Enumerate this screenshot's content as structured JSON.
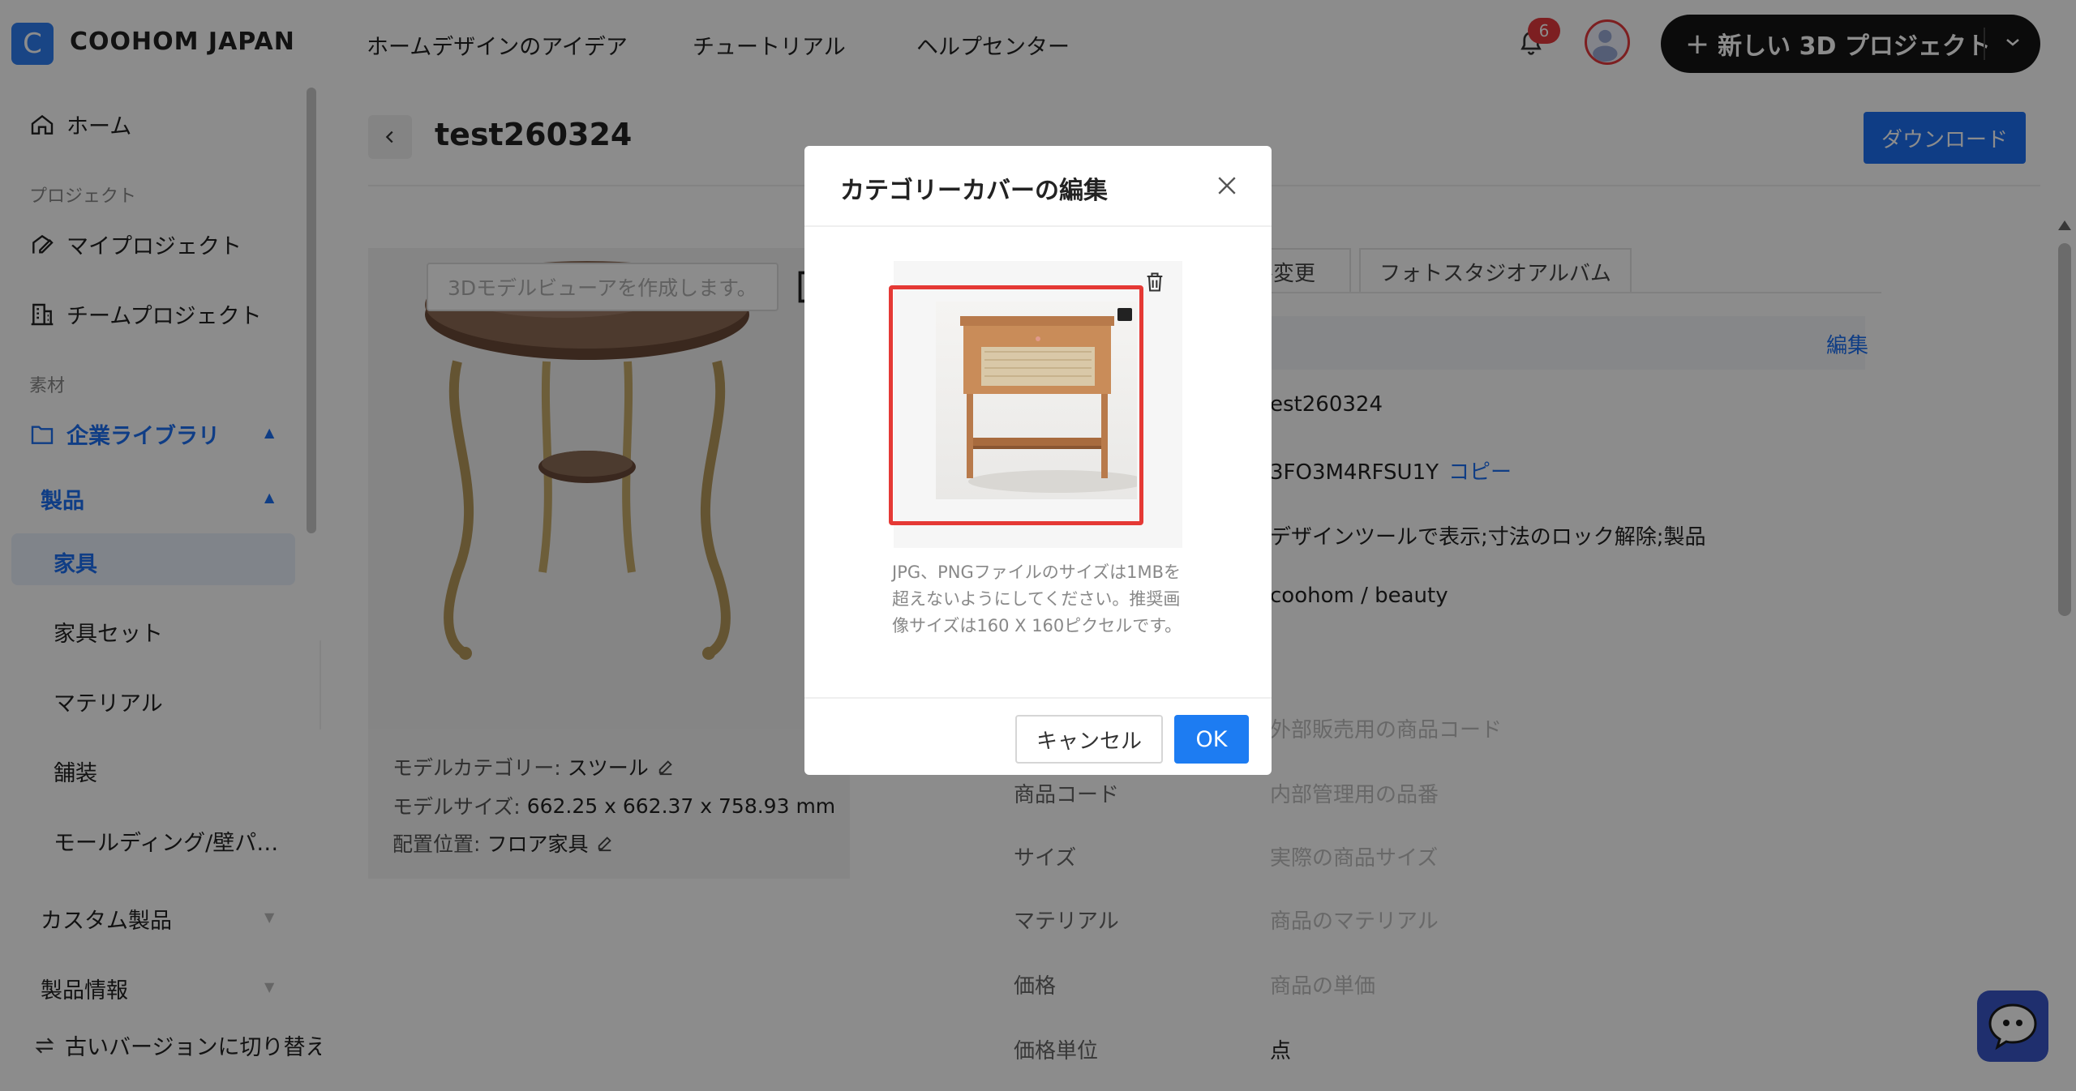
{
  "header": {
    "logo_letter": "C",
    "brand": "COOHOM JAPAN",
    "nav": [
      "ホームデザインのアイデア",
      "チュートリアル",
      "ヘルプセンター"
    ],
    "notification_count": "6",
    "new_project_label": "新しい 3D プロジェクト",
    "plus": "+"
  },
  "sidebar": {
    "home": "ホーム",
    "section_project": "プロジェクト",
    "my_project": "マイプロジェクト",
    "team_project": "チームプロジェクト",
    "section_material": "素材",
    "enterprise_library": "企業ライブラリ",
    "products": "製品",
    "furniture": "家具",
    "furniture_set": "家具セット",
    "material": "マテリアル",
    "pavement": "舗装",
    "molding": "モールディング/壁パ…",
    "custom_products": "カスタム製品",
    "product_info": "製品情報",
    "switch_old": "古いバージョンに切り替え"
  },
  "main": {
    "title": "test260324",
    "download": "ダウンロード",
    "viewer_placeholder": "3Dモデルビューアを作成します。",
    "info": {
      "category_label": "モデルカテゴリー:",
      "category_value": "スツール",
      "size_label": "モデルサイズ:",
      "size_value": "662.25 x 662.37 x 758.93 mm",
      "placement_label": "配置位置:",
      "placement_value": "フロア家具"
    },
    "tabs": [
      "ル変更",
      "フォトスタジオアルバム"
    ],
    "edit": "編集",
    "values_top": {
      "name": "est260324",
      "id": "3FO3M4RFSU1Y",
      "copy": "コピー",
      "tags": "デザインツールで表示;寸法のロック解除;製品",
      "path": "coohom / beauty"
    },
    "rows": [
      {
        "label": "",
        "placeholder": "外部販売用の商品コード"
      },
      {
        "label": "商品コード",
        "placeholder": "内部管理用の品番"
      },
      {
        "label": "サイズ",
        "placeholder": "実際の商品サイズ"
      },
      {
        "label": "マテリアル",
        "placeholder": "商品のマテリアル"
      },
      {
        "label": "価格",
        "placeholder": "商品の単価"
      },
      {
        "label": "価格単位",
        "value": "点"
      }
    ]
  },
  "modal": {
    "title": "カテゴリーカバーの編集",
    "hint": "JPG、PNGファイルのサイズは1MBを超えないようにしてください。推奨画像サイズは160 X 160ピクセルです。",
    "cancel": "キャンセル",
    "ok": "OK"
  }
}
